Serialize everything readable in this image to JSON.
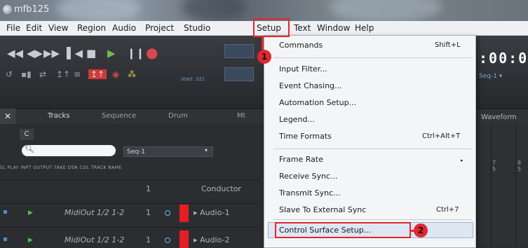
{
  "window": {
    "title": "mfb125"
  },
  "menubar": {
    "items": [
      {
        "label": "File"
      },
      {
        "label": "Edit"
      },
      {
        "label": "View"
      },
      {
        "label": "Region"
      },
      {
        "label": "Audio"
      },
      {
        "label": "Project"
      },
      {
        "label": "Studio"
      },
      {
        "label": "Setup"
      },
      {
        "label": "Text"
      },
      {
        "label": "Window"
      },
      {
        "label": "Help"
      }
    ]
  },
  "toolbar": {
    "counter": ":00:0",
    "seq_small": "Seq-1 ▾",
    "start_small": "start: 321"
  },
  "tabs": [
    {
      "label": "Tracks"
    },
    {
      "label": "Sequence"
    },
    {
      "label": "Drum"
    },
    {
      "label": "MI"
    },
    {
      "label": "Waveform"
    }
  ],
  "tracks_panel": {
    "c_label": "C",
    "sequence_select": "Seq-1",
    "headers": "SL PLAY INPT OUTPUT                TAKE DSN COL  TRACK NAME",
    "conductor": {
      "take": "1",
      "name": "Conductor"
    },
    "rows": [
      {
        "output": "MidiOut 1/2 1-2",
        "take": "1",
        "name": "Audio-1"
      },
      {
        "output": "MidiOut 1/2 1-2",
        "take": "1",
        "name": "Audio-2"
      }
    ]
  },
  "setup_menu": {
    "items": [
      {
        "label": "Commands",
        "shortcut": "Shift+L"
      },
      {
        "label": "Input Filter..."
      },
      {
        "label": "Event Chasing..."
      },
      {
        "label": "Automation Setup..."
      },
      {
        "label": "Legend..."
      },
      {
        "label": "Time Formats",
        "shortcut": "Ctrl+Alt+T"
      },
      {
        "label": "Frame Rate"
      },
      {
        "label": "Receive Sync..."
      },
      {
        "label": "Transmit Sync..."
      },
      {
        "label": "Slave To External Sync",
        "shortcut": "Ctrl+7"
      },
      {
        "label": "Control Surface Setup..."
      }
    ]
  },
  "annotations": {
    "step1": "1",
    "step2": "2",
    "accent": "#e2272f"
  }
}
